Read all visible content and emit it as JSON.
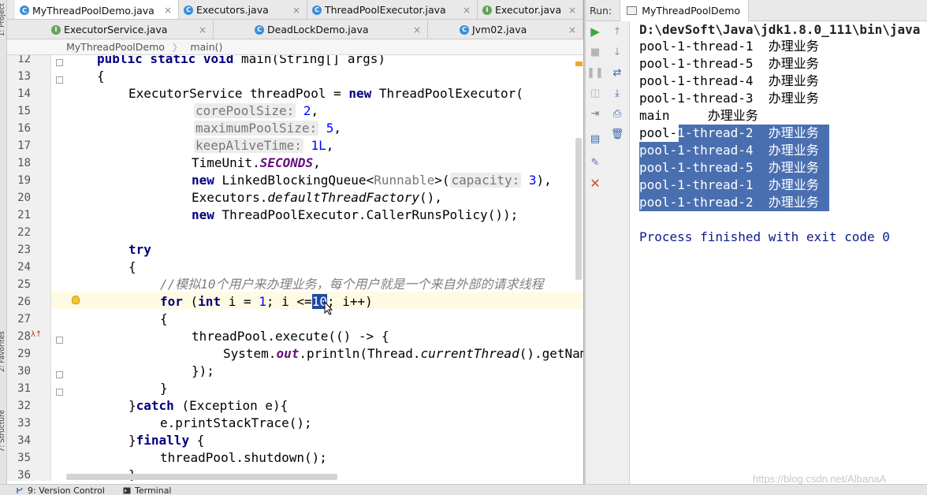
{
  "editor_tabs_row1": [
    {
      "label": "MyThreadPoolDemo.java",
      "icon": "class-icon",
      "active": true
    },
    {
      "label": "Executors.java",
      "icon": "class-icon",
      "active": false
    },
    {
      "label": "ThreadPoolExecutor.java",
      "icon": "class-icon",
      "active": false
    },
    {
      "label": "Executor.java",
      "icon": "interface-icon",
      "active": false
    }
  ],
  "editor_tabs_row2": [
    {
      "label": "ExecutorService.java",
      "icon": "interface-icon"
    },
    {
      "label": "DeadLockDemo.java",
      "icon": "class-icon"
    },
    {
      "label": "Jvm02.java",
      "icon": "class-icon"
    }
  ],
  "breadcrumb": {
    "class": "MyThreadPoolDemo",
    "method": "main()"
  },
  "code_lines": [
    {
      "n": "12"
    },
    {
      "n": "13"
    },
    {
      "n": "14"
    },
    {
      "n": "15"
    },
    {
      "n": "16"
    },
    {
      "n": "17"
    },
    {
      "n": "18"
    },
    {
      "n": "19"
    },
    {
      "n": "20"
    },
    {
      "n": "21"
    },
    {
      "n": "22"
    },
    {
      "n": "23"
    },
    {
      "n": "24"
    },
    {
      "n": "25"
    },
    {
      "n": "26"
    },
    {
      "n": "27"
    },
    {
      "n": "28"
    },
    {
      "n": "29"
    },
    {
      "n": "30"
    },
    {
      "n": "31"
    },
    {
      "n": "32"
    },
    {
      "n": "33"
    },
    {
      "n": "34"
    },
    {
      "n": "35"
    },
    {
      "n": "36"
    }
  ],
  "code": {
    "l12_kw": "public static void",
    "l12_rest": " main(String[] args)",
    "l13": "{",
    "l14_a": "ExecutorService threadPool = ",
    "l14_kw": "new",
    "l14_b": " ThreadPoolExecutor(",
    "l15_hint": "corePoolSize:",
    "l15_val": "2",
    "l15_end": ",",
    "l16_hint": "maximumPoolSize:",
    "l16_val": "5",
    "l16_end": ",",
    "l17_hint": "keepAliveTime:",
    "l17_val": "1L",
    "l17_end": ",",
    "l18_a": "TimeUnit.",
    "l18_st": "SECONDS",
    "l18_end": ",",
    "l19_kw": "new",
    "l19_a": " LinkedBlockingQueue<",
    "l19_gen": "Runnable",
    "l19_b": ">(",
    "l19_hint": "capacity:",
    "l19_val": "3",
    "l19_end": "),",
    "l20_a": "Executors.",
    "l20_it": "defaultThreadFactory",
    "l20_end": "(),",
    "l21_kw": "new",
    "l21_a": " ThreadPoolExecutor.CallerRunsPolicy());",
    "l23_kw": "try",
    "l24": "{",
    "l25_cm": "//模拟10个用户来办理业务，每个用户就是一个来自外部的请求线程",
    "l26_kw1": "for",
    "l26_a": " (",
    "l26_kw2": "int",
    "l26_b": " i = ",
    "l26_v1": "1",
    "l26_c": "; i <=",
    "l26_sel": "10",
    "l26_d": "; i++)",
    "l27": "{",
    "l28_a": "threadPool.execute(() -> {",
    "l29_a": "System.",
    "l29_st": "out",
    "l29_b": ".println(Thread.",
    "l29_it": "currentThread",
    "l29_c": "().getName()",
    "l30": "});",
    "l31": "}",
    "l32_a": "}",
    "l32_kw": "catch",
    "l32_b": " (Exception e){",
    "l33": "e.printStackTrace();",
    "l34_a": "}",
    "l34_kw": "finally",
    "l34_b": " {",
    "l35": "threadPool.shutdown();",
    "l36": "}"
  },
  "run_panel": {
    "label": "Run:",
    "tab": "MyThreadPoolDemo",
    "console_lines": [
      "D:\\devSoft\\Java\\jdk1.8.0_111\\bin\\java",
      "pool-1-thread-1  办理业务",
      "pool-1-thread-5  办理业务",
      "pool-1-thread-4  办理业务",
      "pool-1-thread-3  办理业务",
      "main     办理业务",
      "pool-1-thread-2  办理业务",
      "pool-1-thread-4  办理业务",
      "pool-1-thread-5  办理业务",
      "pool-1-thread-1  办理业务",
      "pool-1-thread-2  办理业务",
      "",
      "Process finished with exit code 0"
    ]
  },
  "status_bar": {
    "version_control": "9: Version Control",
    "terminal": "Terminal"
  },
  "left_strip": {
    "top": "1: Project",
    "favorites": "2: Favorites",
    "structure": "7: Structure"
  },
  "watermark": "https://blog.csdn.net/AlbanaA",
  "colors": {
    "keyword": "#000080",
    "static": "#660e7a",
    "number": "#0000ff",
    "comment": "#808080",
    "selection": "#2149a3",
    "console_selection": "#4a6fb0"
  }
}
